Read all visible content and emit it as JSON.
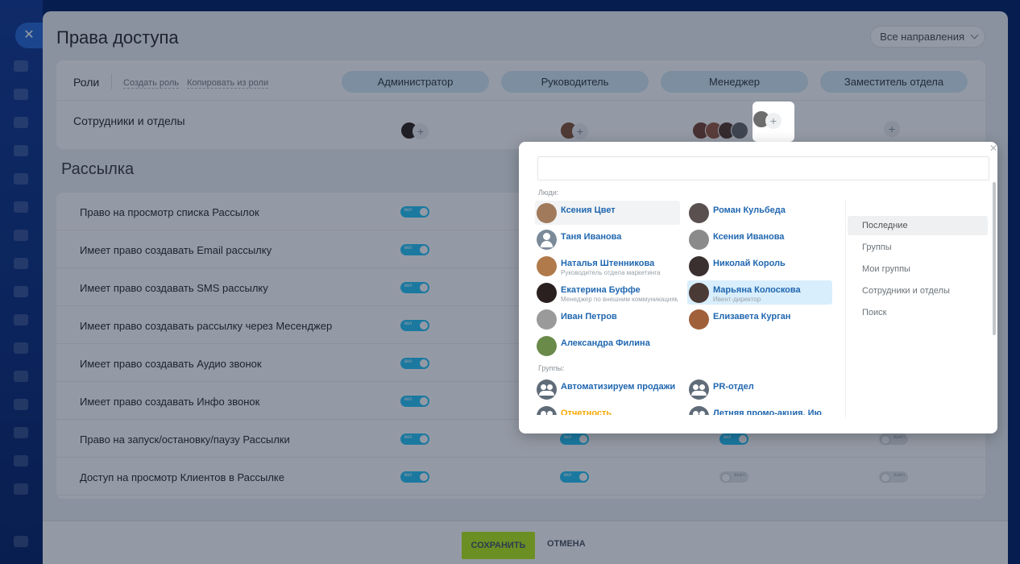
{
  "header": {
    "title": "Права доступа",
    "direction_select": "Все направления"
  },
  "roles": {
    "label": "Роли",
    "create_role": "Создать роль",
    "copy_role": "Копировать из роли",
    "columns": [
      "Администратор",
      "Руководитель",
      "Менеджер",
      "Заместитель отдела"
    ],
    "employees_label": "Сотрудники и отделы"
  },
  "section": {
    "title": "Рассылка"
  },
  "permissions": [
    {
      "label": "Право на просмотр списка Рассылок",
      "values": [
        true
      ]
    },
    {
      "label": "Имеет право создавать Email рассылку",
      "values": [
        true
      ]
    },
    {
      "label": "Имеет право создавать SMS рассылку",
      "values": [
        true
      ]
    },
    {
      "label": "Имеет право создавать рассылку через Месенджер",
      "values": [
        true
      ]
    },
    {
      "label": "Имеет право создавать Аудио звонок",
      "values": [
        true
      ]
    },
    {
      "label": "Имеет право создавать Инфо звонок",
      "values": [
        true
      ]
    },
    {
      "label": "Право на запуск/остановку/паузу Рассылки",
      "values": [
        true,
        true,
        true,
        false
      ]
    },
    {
      "label": "Доступ на просмотр Клиентов в Рассылке",
      "values": [
        true,
        true,
        false,
        false
      ]
    }
  ],
  "toggle_labels": {
    "on": "вкл",
    "off": "выкл"
  },
  "footer": {
    "save": "СОХРАНИТЬ",
    "cancel": "ОТМЕНА"
  },
  "popup": {
    "search_value": "",
    "people_label": "Люди:",
    "groups_label": "Группы:",
    "people": [
      {
        "name": "Ксения Цвет",
        "subtitle": ""
      },
      {
        "name": "Роман Кульбеда",
        "subtitle": ""
      },
      {
        "name": "Таня Иванова",
        "subtitle": ""
      },
      {
        "name": "Ксения Иванова",
        "subtitle": ""
      },
      {
        "name": "Наталья Штенникова",
        "subtitle": "Руководитель отдела маркетинга"
      },
      {
        "name": "Николай Король",
        "subtitle": ""
      },
      {
        "name": "Екатерина Буффе",
        "subtitle": "Менеджер по внешним коммуникациям"
      },
      {
        "name": "Марьяна Колоскова",
        "subtitle": "Ивент-директор"
      },
      {
        "name": "Иван Петров",
        "subtitle": ""
      },
      {
        "name": "Елизавета Курган",
        "subtitle": ""
      },
      {
        "name": "Александра Филина",
        "subtitle": ""
      }
    ],
    "groups": [
      {
        "name": "Автоматизируем продажи"
      },
      {
        "name": "PR-отдел"
      },
      {
        "name": "Отчетность"
      },
      {
        "name": "Летняя промо-акция. Ию"
      }
    ],
    "tabs": [
      "Последние",
      "Группы",
      "Мои группы",
      "Сотрудники и отделы",
      "Поиск"
    ],
    "active_tab": "Последние"
  },
  "colors": {
    "accent": "#2fc6f6",
    "role_pill": "#d7eaf7",
    "save_button": "#bbed21",
    "link": "#2067b0",
    "overlay": "rgba(0,14,40,0.42)"
  }
}
